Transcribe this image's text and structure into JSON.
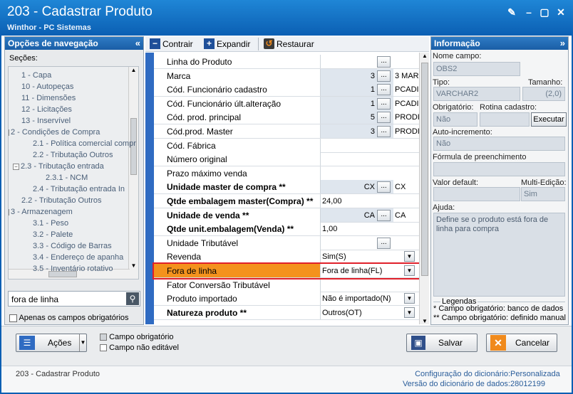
{
  "window": {
    "title": "203 - Cadastrar  Produto",
    "subtitle": "Winthor - PC Sistemas"
  },
  "nav": {
    "header": "Opções de navegação",
    "sections_label": "Seções:",
    "tree": [
      {
        "label": "1 - Capa",
        "indent": 1
      },
      {
        "label": "10 - Autopeças",
        "indent": 1
      },
      {
        "label": "11 - Dimensões",
        "indent": 1
      },
      {
        "label": "12 - Licitações",
        "indent": 1
      },
      {
        "label": "13 - Inservível",
        "indent": 1
      },
      {
        "label": "2 - Condições de Compra",
        "indent": 0,
        "expander": "−"
      },
      {
        "label": "2.1 - Política comercial compr",
        "indent": 2
      },
      {
        "label": "2.2 - Tributação Outros",
        "indent": 2
      },
      {
        "label": "2.3 - Tributação entrada",
        "indent": 1,
        "expander": "−"
      },
      {
        "label": "2.3.1 - NCM",
        "indent": 3
      },
      {
        "label": "2.4 - Tributação entrada In",
        "indent": 2
      },
      {
        "label": "2.2 - Tributação Outros",
        "indent": 1
      },
      {
        "label": "3 - Armazenagem",
        "indent": 0,
        "expander": "−"
      },
      {
        "label": "3.1 - Peso",
        "indent": 2
      },
      {
        "label": "3.2 - Palete",
        "indent": 2
      },
      {
        "label": "3.3 - Código de Barras",
        "indent": 2
      },
      {
        "label": "3.4 - Endereço de apanha",
        "indent": 2
      },
      {
        "label": "3.5 - Inventário rotativo",
        "indent": 2
      }
    ],
    "search_value": "fora de linha",
    "only_required_label": "Apenas os campos obrigatórios"
  },
  "toolbar": {
    "collapse_label": "Contrair",
    "expand_label": "Expandir",
    "restore_label": "Restaurar"
  },
  "grid": {
    "rows": [
      {
        "label": "Linha do Produto",
        "bold": false,
        "num": "",
        "code": "",
        "ellipsis": true
      },
      {
        "label": "Marca",
        "bold": false,
        "num": "3",
        "code": "3 MAR",
        "ellipsis": true
      },
      {
        "label": "Cód. Funcionário cadastro",
        "bold": false,
        "num": "1",
        "code": "PCADI",
        "ellipsis": true
      },
      {
        "label": "Cód. Funcionário últ.alteração",
        "bold": false,
        "num": "1",
        "code": "PCADI",
        "ellipsis": true
      },
      {
        "label": "Cód. prod. principal",
        "bold": false,
        "num": "5",
        "code": "PRODI",
        "ellipsis": true
      },
      {
        "label": "Cód.prod. Master",
        "bold": false,
        "num": "3",
        "code": "PRODI",
        "ellipsis": true
      },
      {
        "label": "Cód. Fábrica",
        "bold": false,
        "num": "",
        "code": "",
        "ellipsis": false
      },
      {
        "label": "Número original",
        "bold": false,
        "num": "",
        "code": "",
        "ellipsis": false
      },
      {
        "label": "Prazo máximo venda",
        "bold": false,
        "num": "",
        "code": "",
        "ellipsis": false
      },
      {
        "label": "Unidade master de compra **",
        "bold": true,
        "num": "CX",
        "code": "CX",
        "ellipsis": true
      },
      {
        "label": "Qtde embalagem master(Compra) **",
        "bold": true,
        "text": "24,00"
      },
      {
        "label": "Unidade de venda **",
        "bold": true,
        "num": "CA",
        "code": "CA",
        "ellipsis": true
      },
      {
        "label": "Qtde unit.embalagem(Venda) **",
        "bold": true,
        "text": "1,00"
      },
      {
        "label": "Unidade Tributável",
        "bold": false,
        "num": "",
        "code": "",
        "ellipsis": true
      },
      {
        "label": "Revenda",
        "bold": false,
        "select": "Sim(S)"
      },
      {
        "label": "Fora de linha",
        "bold": false,
        "select": "Fora de linha(FL)",
        "highlight": true
      },
      {
        "label": "Fator Conversão Tributável",
        "bold": false,
        "text": ""
      },
      {
        "label": "Produto importado",
        "bold": false,
        "select": "Não é importado(N)"
      },
      {
        "label": "Natureza produto **",
        "bold": true,
        "select": "Outros(OT)"
      }
    ]
  },
  "info": {
    "header": "Informação",
    "field_name_label": "Nome campo:",
    "field_name": "OBS2",
    "type_label": "Tipo:",
    "type": "VARCHAR2",
    "size_label": "Tamanho:",
    "size": "(2,0)",
    "required_label": "Obrigatório:",
    "required": "Não",
    "routine_label": "Rotina cadastro:",
    "execute_label": "Executar",
    "autoinc_label": "Auto-incremento:",
    "autoinc": "Não",
    "formula_label": "Fórmula de preenchimento",
    "default_label": "Valor default:",
    "multiedit_label": "Multi-Edição:",
    "multiedit": "Sim",
    "help_label": "Ajuda:",
    "help_text": "Define se o produto está fora de linha para compra",
    "legend_title": "Legendas",
    "legend_1": "* Campo obrigatório: banco de dados",
    "legend_2": "** Campo obrigatório: definido manual"
  },
  "bottom": {
    "actions_label": "Ações",
    "legend_required": "Campo obrigatório",
    "legend_not_editable": "Campo não editável",
    "save_label": "Salvar",
    "cancel_label": "Cancelar"
  },
  "status": {
    "routine": "203 - Cadastrar  Produto",
    "dict_config_label": "Configuração do dicionário:",
    "dict_config_value": "Personalizada",
    "dict_version_label": "Versão do dicionário de dados:",
    "dict_version_value": "28012199"
  },
  "colors": {
    "title_bar": "#1a74c9",
    "highlight_row": "#f4921d",
    "highlight_border": "#e0202a",
    "link": "#2a5d9a"
  }
}
